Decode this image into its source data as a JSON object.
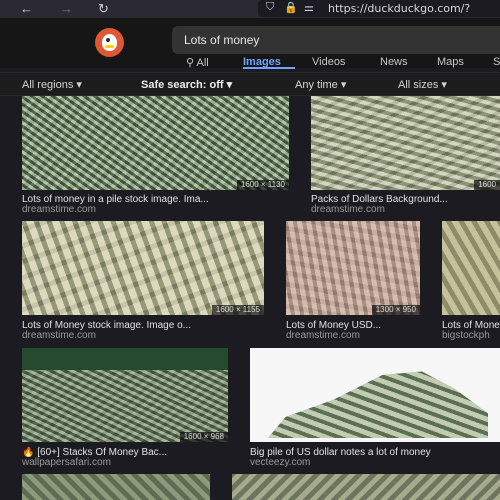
{
  "browser": {
    "back_icon": "arrow-left-icon",
    "forward_icon": "arrow-right-icon",
    "reload_icon": "reload-icon",
    "url": "https://duckduckgo.com/?"
  },
  "search": {
    "query": "Lots of money"
  },
  "tabs": [
    {
      "label": "All",
      "icon": "search-icon"
    },
    {
      "label": "Images",
      "active": true
    },
    {
      "label": "Videos"
    },
    {
      "label": "News"
    },
    {
      "label": "Maps"
    },
    {
      "label": "S"
    }
  ],
  "filters": [
    {
      "label": "All regions ▾"
    },
    {
      "label": "Safe search: off ▾"
    },
    {
      "label": "Any time ▾"
    },
    {
      "label": "All sizes ▾"
    }
  ],
  "results": [
    {
      "caption": "Lots of money in a pile stock image. Ima...",
      "source": "dreamstime.com",
      "size": "1600 × 1130"
    },
    {
      "caption": "Packs of Dollars Background...",
      "source": "dreamstime.com",
      "size": "1600"
    },
    {
      "caption": "Lots of Money stock image. Image o...",
      "source": "dreamstime.com",
      "size": "1600 × 1155"
    },
    {
      "caption": "Lots of Money USD...",
      "source": "dreamstime.com",
      "size": "1300 × 950"
    },
    {
      "caption": "Lots of Mone",
      "source": "bigstockph"
    },
    {
      "caption": "[60+] Stacks Of Money Bac...",
      "source": "wallpapersafari.com",
      "size": "1600 × 968"
    },
    {
      "caption": "Big pile of US dollar notes a lot of money",
      "source": "vecteezy.com"
    }
  ],
  "accent_color": "#6ea3ff",
  "brand_color": "#de5833"
}
